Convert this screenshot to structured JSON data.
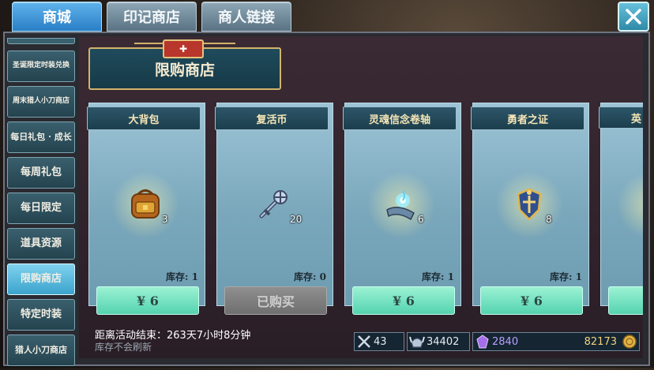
{
  "tabs": [
    {
      "label": "商城",
      "active": true
    },
    {
      "label": "印记商店",
      "active": false
    },
    {
      "label": "商人链接",
      "active": false
    }
  ],
  "close_icon": "close-icon",
  "sidebar": {
    "items": [
      {
        "label": "圣诞限定时装兑换",
        "active": false
      },
      {
        "label": "周末猎人小刀商店",
        "active": false
      },
      {
        "label": "每日礼包 · 成长",
        "active": false
      },
      {
        "label": "每周礼包",
        "active": false
      },
      {
        "label": "每日限定",
        "active": false
      },
      {
        "label": "道具资源",
        "active": false
      },
      {
        "label": "限购商店",
        "active": true
      },
      {
        "label": "特定时装",
        "active": false
      },
      {
        "label": "猎人小刀商店",
        "active": false
      }
    ]
  },
  "shop": {
    "title": "限购商店",
    "items": [
      {
        "name": "大背包",
        "quantity": "3",
        "stock_label": "库存:",
        "stock": "1",
        "button": "¥ 6",
        "purchased": false,
        "icon": "backpack-icon"
      },
      {
        "name": "复活币",
        "quantity": "20",
        "stock_label": "库存:",
        "stock": "0",
        "button": "已购买",
        "purchased": true,
        "icon": "revive-coin-icon"
      },
      {
        "name": "灵魂信念卷轴",
        "quantity": "6",
        "stock_label": "库存:",
        "stock": "1",
        "button": "¥ 6",
        "purchased": false,
        "icon": "soul-scroll-icon"
      },
      {
        "name": "勇者之证",
        "quantity": "8",
        "stock_label": "库存:",
        "stock": "1",
        "button": "¥ 6",
        "purchased": false,
        "icon": "brave-badge-icon"
      },
      {
        "name": "英",
        "quantity": "",
        "stock_label": "",
        "stock": "",
        "button": "",
        "purchased": false,
        "icon": "hero-item-icon"
      }
    ]
  },
  "footer": {
    "countdown": "距离活动结束：263天7小时8分钟",
    "note": "库存不会刷新"
  },
  "resources": [
    {
      "icon": "crossed-swords-icon",
      "value": "43"
    },
    {
      "icon": "horn-helmet-icon",
      "value": "34402"
    },
    {
      "icon": "purple-gem-icon",
      "value": "2840"
    },
    {
      "icon": "gold-coin-icon",
      "value": "82173"
    }
  ],
  "colors": {
    "active_tab": "#2a7fc6",
    "buy_button": "#55d3b0",
    "bought_button": "#6f6f6f",
    "card_bg": "#9cc4d6"
  }
}
